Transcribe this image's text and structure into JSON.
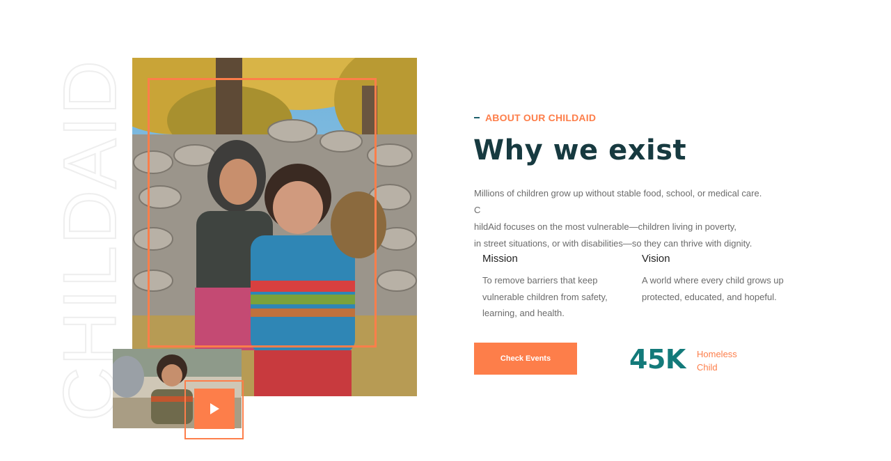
{
  "watermark": {
    "text": "CHILDAID"
  },
  "about": {
    "eyebrow": "ABOUT OUR CHILDAID",
    "title": "Why we exist",
    "intro_lines": [
      "Millions of children grow up without stable food, school, or medical care. C",
      "hildAid focuses on the most vulnerable—children living in poverty,",
      "in street situations, or with disabilities—so they can thrive with dignity."
    ]
  },
  "mission": {
    "title": "Mission",
    "lines": [
      "To remove barriers that keep",
      "vulnerable children from safety,",
      "learning, and health."
    ]
  },
  "vision": {
    "title": "Vision",
    "lines": [
      "A world where every child grows up",
      "protected, educated, and hopeful."
    ]
  },
  "cta": {
    "label": "Check Events"
  },
  "stat": {
    "value": "45K",
    "label_lines": [
      "Homeless",
      "Child"
    ]
  },
  "icons": {
    "play": "play-icon"
  },
  "colors": {
    "accent": "#fd7e4a",
    "heading": "#173a40",
    "teal": "#137a7a"
  }
}
